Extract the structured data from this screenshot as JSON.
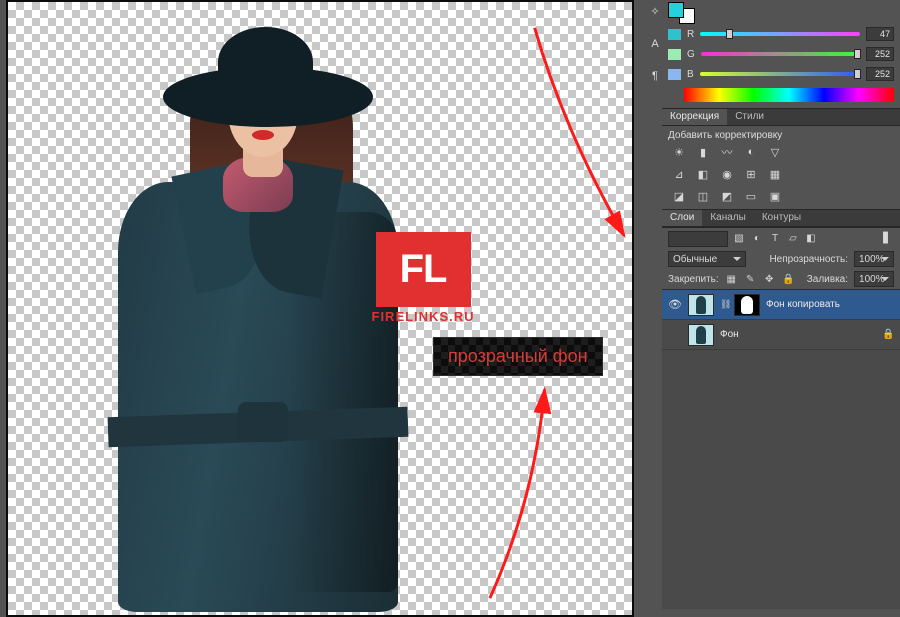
{
  "color_panel": {
    "channels": [
      {
        "label": "R",
        "value": 47,
        "thumb_pct": 18,
        "grad": "grad-r",
        "sw": "sw-r"
      },
      {
        "label": "G",
        "value": 252,
        "thumb_pct": 98,
        "grad": "grad-g",
        "sw": "sw-g"
      },
      {
        "label": "B",
        "value": 252,
        "thumb_pct": 98,
        "grad": "grad-b",
        "sw": "sw-b"
      }
    ],
    "foreground": "#27d1db",
    "background": "#ffffff"
  },
  "adjustments": {
    "tabs": [
      "Коррекция",
      "Стили"
    ],
    "active_tab": 0,
    "add_label": "Добавить корректировку"
  },
  "layers_panel": {
    "tabs": [
      "Слои",
      "Каналы",
      "Контуры"
    ],
    "active_tab": 0,
    "blend_mode": "Обычные",
    "opacity_label": "Непрозрачность:",
    "opacity_value": "100%",
    "lock_label": "Закрепить:",
    "fill_label": "Заливка:",
    "fill_value": "100%",
    "layers": [
      {
        "visible": true,
        "has_mask": true,
        "name": "Фон копировать",
        "locked": false,
        "selected": true
      },
      {
        "visible": false,
        "has_mask": false,
        "name": "Фон",
        "locked": true,
        "selected": false
      }
    ]
  },
  "watermark": {
    "logo": "FL",
    "site": "FIRELINKS.RU"
  },
  "callout": {
    "text": "прозрачный фон"
  }
}
